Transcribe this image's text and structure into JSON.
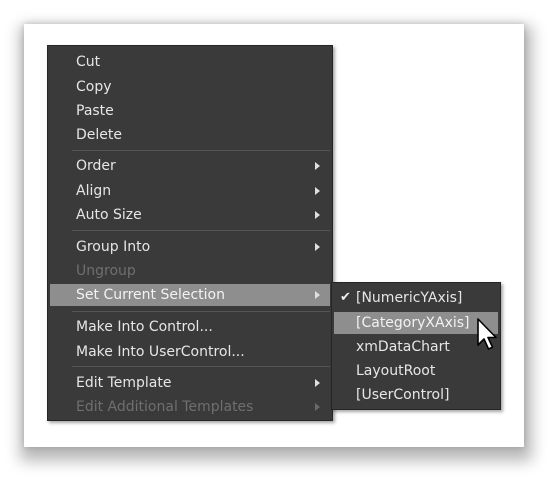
{
  "main_menu": {
    "items": [
      {
        "label": "Cut",
        "enabled": true,
        "submenu": false
      },
      {
        "label": "Copy",
        "enabled": true,
        "submenu": false
      },
      {
        "label": "Paste",
        "enabled": true,
        "submenu": false
      },
      {
        "label": "Delete",
        "enabled": true,
        "submenu": false
      },
      {
        "label": "Order",
        "enabled": true,
        "submenu": true
      },
      {
        "label": "Align",
        "enabled": true,
        "submenu": true
      },
      {
        "label": "Auto Size",
        "enabled": true,
        "submenu": true
      },
      {
        "label": "Group Into",
        "enabled": true,
        "submenu": true
      },
      {
        "label": "Ungroup",
        "enabled": false,
        "submenu": false
      },
      {
        "label": "Set Current Selection",
        "enabled": true,
        "submenu": true,
        "highlighted": true
      },
      {
        "label": "Make Into Control...",
        "enabled": true,
        "submenu": false
      },
      {
        "label": "Make Into UserControl...",
        "enabled": true,
        "submenu": false
      },
      {
        "label": "Edit Template",
        "enabled": true,
        "submenu": true
      },
      {
        "label": "Edit Additional Templates",
        "enabled": false,
        "submenu": true
      }
    ]
  },
  "sub_menu": {
    "items": [
      {
        "label": "[NumericYAxis]",
        "checked": true
      },
      {
        "label": "[CategoryXAxis]",
        "checked": false,
        "highlighted": true
      },
      {
        "label": "xmDataChart",
        "checked": false
      },
      {
        "label": "LayoutRoot",
        "checked": false
      },
      {
        "label": "[UserControl]",
        "checked": false
      }
    ]
  },
  "icons": {
    "check": "check-mark-icon",
    "submenu_arrow": "submenu-arrow-icon",
    "cursor": "mouse-pointer-icon"
  },
  "colors": {
    "menu_background": "#3a3a3a",
    "highlight": "#8e8e8e",
    "text": "#e6e6e6",
    "disabled_text": "#6f6f6f",
    "separator": "#555555"
  }
}
